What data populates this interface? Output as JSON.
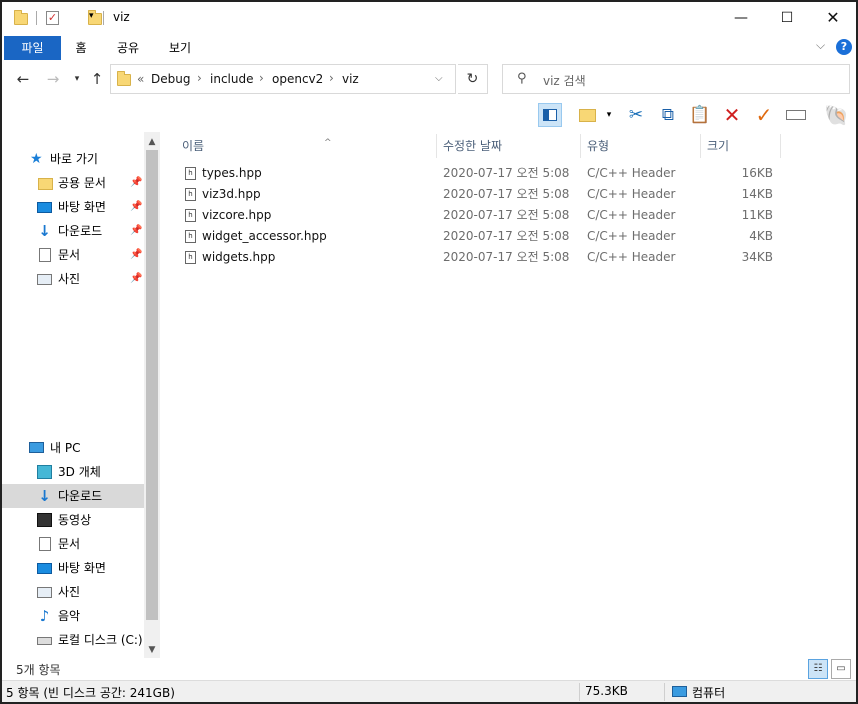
{
  "window": {
    "title": "viz"
  },
  "ribbon": {
    "tabs": [
      "파일",
      "홈",
      "공유",
      "보기"
    ],
    "expand_icon": "chevron-down-icon",
    "help_label": "?"
  },
  "address": {
    "overflow": "«",
    "crumbs": [
      "Debug",
      "include",
      "opencv2",
      "viz"
    ],
    "search_placeholder": "viz 검색"
  },
  "navpane": {
    "quick_access": {
      "label": "바로 가기"
    },
    "quick_items": [
      {
        "label": "공용 문서",
        "icon": "folder-icon"
      },
      {
        "label": "바탕 화면",
        "icon": "desktop-icon"
      },
      {
        "label": "다운로드",
        "icon": "download-icon"
      },
      {
        "label": "문서",
        "icon": "document-icon"
      },
      {
        "label": "사진",
        "icon": "picture-icon"
      }
    ],
    "this_pc": {
      "label": "내 PC"
    },
    "pc_items": [
      {
        "label": "3D 개체",
        "icon": "3d-objects-icon"
      },
      {
        "label": "다운로드",
        "icon": "download-icon",
        "selected": true
      },
      {
        "label": "동영상",
        "icon": "video-icon"
      },
      {
        "label": "문서",
        "icon": "document-icon"
      },
      {
        "label": "바탕 화면",
        "icon": "desktop-icon"
      },
      {
        "label": "사진",
        "icon": "picture-icon"
      },
      {
        "label": "음악",
        "icon": "music-icon"
      },
      {
        "label": "로컬 디스크 (C:)",
        "icon": "disk-icon"
      }
    ]
  },
  "filelist": {
    "columns": {
      "name": "이름",
      "modified": "수정한 날짜",
      "type": "유형",
      "size": "크기"
    },
    "files": [
      {
        "name": "types.hpp",
        "modified": "2020-07-17 오전 5:08",
        "type": "C/C++ Header",
        "size": "16KB"
      },
      {
        "name": "viz3d.hpp",
        "modified": "2020-07-17 오전 5:08",
        "type": "C/C++ Header",
        "size": "14KB"
      },
      {
        "name": "vizcore.hpp",
        "modified": "2020-07-17 오전 5:08",
        "type": "C/C++ Header",
        "size": "11KB"
      },
      {
        "name": "widget_accessor.hpp",
        "modified": "2020-07-17 오전 5:08",
        "type": "C/C++ Header",
        "size": "4KB"
      },
      {
        "name": "widgets.hpp",
        "modified": "2020-07-17 오전 5:08",
        "type": "C/C++ Header",
        "size": "34KB"
      }
    ]
  },
  "status": {
    "item_count": "5개 항목",
    "info_left": "5 항목 (빈 디스크 공간: 241GB)",
    "info_size": "75.3KB",
    "info_location": "컴퓨터"
  },
  "colors": {
    "accent": "#1a66c4",
    "selection": "#d9d9d9",
    "delete": "#d02020",
    "check": "#e06a10"
  }
}
